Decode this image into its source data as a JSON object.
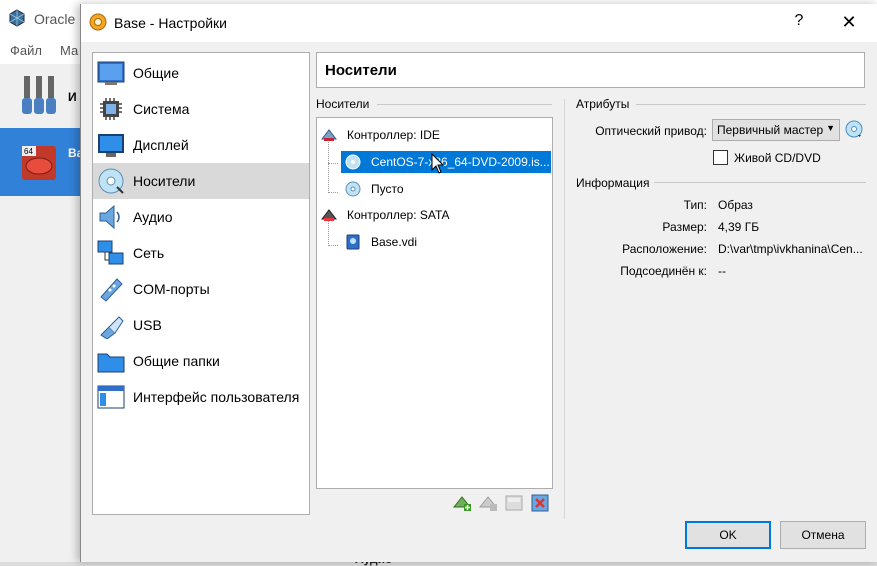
{
  "background_window": {
    "title": "Oracle",
    "menu": [
      "Файл",
      "Ма"
    ],
    "tools_label": "И",
    "vm_name": "Ва",
    "bottom_text": "Аудио"
  },
  "dialog": {
    "title": "Base - Настройки",
    "help_symbol": "?",
    "close_symbol": "✕"
  },
  "categories": [
    {
      "label": "Общие",
      "icon": "general-icon"
    },
    {
      "label": "Система",
      "icon": "system-icon"
    },
    {
      "label": "Дисплей",
      "icon": "display-icon"
    },
    {
      "label": "Носители",
      "icon": "storage-icon",
      "selected": true
    },
    {
      "label": "Аудио",
      "icon": "audio-icon"
    },
    {
      "label": "Сеть",
      "icon": "network-icon"
    },
    {
      "label": "COM-порты",
      "icon": "serial-ports-icon"
    },
    {
      "label": "USB",
      "icon": "usb-icon"
    },
    {
      "label": "Общие папки",
      "icon": "shared-folders-icon"
    },
    {
      "label": "Интерфейс пользователя",
      "icon": "user-interface-icon"
    }
  ],
  "page": {
    "title": "Носители"
  },
  "storage": {
    "group_label": "Носители",
    "tree": [
      {
        "label": "Контроллер: IDE",
        "type": "controller"
      },
      {
        "label": "CentOS-7-x86_64-DVD-2009.is...",
        "type": "optical",
        "selected": true
      },
      {
        "label": "Пусто",
        "type": "optical"
      },
      {
        "label": "Контроллер: SATA",
        "type": "controller"
      },
      {
        "label": "Base.vdi",
        "type": "disk"
      }
    ]
  },
  "attributes": {
    "group_label": "Атрибуты",
    "optical_drive_label": "Оптический привод:",
    "optical_drive_value": "Первичный мастер",
    "live_cd_label": "Живой CD/DVD",
    "live_cd_checked": false
  },
  "information": {
    "group_label": "Информация",
    "rows": [
      {
        "label": "Тип:",
        "value": "Образ"
      },
      {
        "label": "Размер:",
        "value": "4,39 ГБ"
      },
      {
        "label": "Расположение:",
        "value": "D:\\var\\tmp\\ivkhanina\\Cen..."
      },
      {
        "label": "Подсоединён к:",
        "value": "--"
      }
    ]
  },
  "buttons": {
    "ok": "OK",
    "cancel": "Отмена"
  },
  "colors": {
    "selection": "#0078d7",
    "vm_selected": "#3281d9"
  }
}
